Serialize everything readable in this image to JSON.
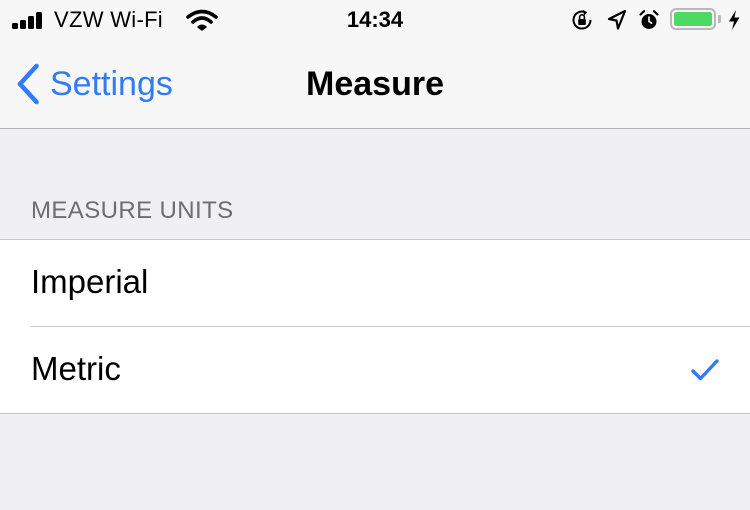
{
  "status_bar": {
    "carrier": "VZW Wi-Fi",
    "time": "14:34",
    "battery_level": 1.0,
    "icons": [
      "signal-icon",
      "wifi-icon",
      "orientation-lock-icon",
      "location-arrow-icon",
      "alarm-icon",
      "battery-icon",
      "charging-bolt-icon"
    ]
  },
  "nav": {
    "back_label": "Settings",
    "title": "Measure"
  },
  "section": {
    "header": "MEASURE UNITS",
    "items": [
      {
        "label": "Imperial",
        "selected": false
      },
      {
        "label": "Metric",
        "selected": true
      }
    ]
  },
  "colors": {
    "accent": "#2f7cf6",
    "background": "#efeff4",
    "battery": "#4cd964",
    "section_header": "#6d6d72"
  }
}
